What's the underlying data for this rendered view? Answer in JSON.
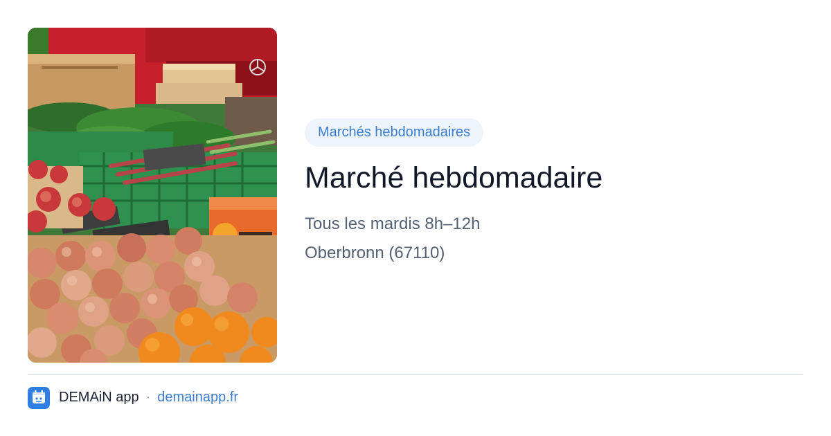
{
  "photo": {
    "description_icon": "market-produce-photo"
  },
  "category_chip": "Marchés hebdomadaires",
  "title": "Marché hebdomadaire",
  "schedule": "Tous les mardis 8h–12h",
  "location": "Oberbronn (67110)",
  "footer": {
    "app_icon": "demain-app-icon",
    "app_name": "DEMAiN app",
    "separator": "·",
    "link": "demainapp.fr"
  },
  "colors": {
    "chip_bg": "#eef4fb",
    "accent": "#3b7dd0",
    "title": "#101828",
    "muted": "#536173"
  }
}
